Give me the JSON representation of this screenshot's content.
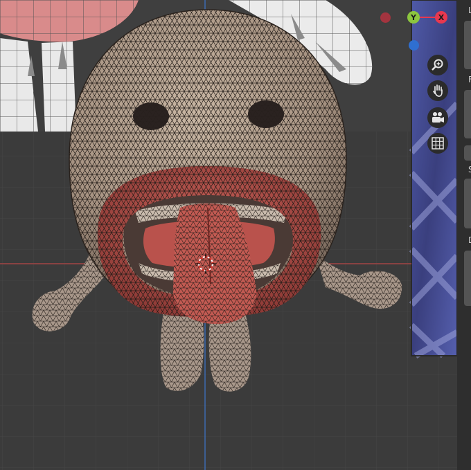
{
  "gizmo": {
    "y_label": "Y",
    "x_label": "X",
    "colors": {
      "x": "#e8384f",
      "y": "#8cc63f",
      "z": "#2f6fd1",
      "neg_x": "#b5323f"
    }
  },
  "nav_buttons": [
    {
      "name": "zoom-icon"
    },
    {
      "name": "pan-hand-icon"
    },
    {
      "name": "camera-icon"
    },
    {
      "name": "grid-view-icon"
    }
  ],
  "properties_panel": {
    "section_labels": [
      "L",
      "F",
      "S",
      "D"
    ]
  },
  "colors": {
    "viewport_bg": "#3b3b3b",
    "grid_line": "#444444",
    "axis_x": "#b04545",
    "axis_y": "#3b6fb0",
    "skin": "#b6a28e",
    "lip": "#b9524c",
    "wire": "#1f1a17"
  }
}
